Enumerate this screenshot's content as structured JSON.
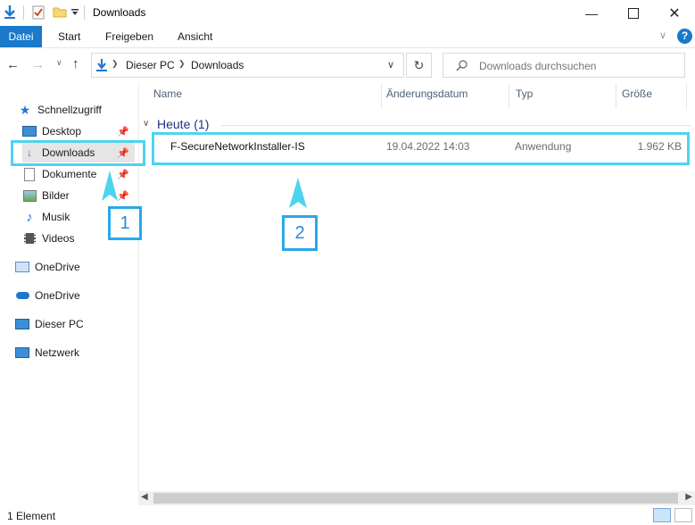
{
  "window": {
    "title": "Downloads"
  },
  "ribbon": {
    "tabs": [
      "Datei",
      "Start",
      "Freigeben",
      "Ansicht"
    ]
  },
  "address": {
    "crumbs": [
      "Dieser PC",
      "Downloads"
    ]
  },
  "search": {
    "placeholder": "Downloads durchsuchen"
  },
  "nav": {
    "quick_access": "Schnellzugriff",
    "pinned": [
      {
        "label": "Desktop",
        "icon": "desktop-icon",
        "pinned": true
      },
      {
        "label": "Downloads",
        "icon": "downloads-icon",
        "pinned": true
      },
      {
        "label": "Dokumente",
        "icon": "document-icon",
        "pinned": true
      },
      {
        "label": "Bilder",
        "icon": "pictures-icon",
        "pinned": true
      },
      {
        "label": "Musik",
        "icon": "music-icon",
        "pinned": false
      },
      {
        "label": "Videos",
        "icon": "video-icon",
        "pinned": false
      }
    ],
    "roots": [
      {
        "label": "OneDrive",
        "icon": "onedrive-business-icon"
      },
      {
        "label": "OneDrive",
        "icon": "onedrive-icon"
      },
      {
        "label": "Dieser PC",
        "icon": "this-pc-icon"
      },
      {
        "label": "Netzwerk",
        "icon": "network-icon"
      }
    ]
  },
  "columns": [
    "Name",
    "Änderungsdatum",
    "Typ",
    "Größe"
  ],
  "group": {
    "label": "Heute (1)"
  },
  "files": [
    {
      "name": "F-SecureNetworkInstaller-IS",
      "date": "19.04.2022 14:03",
      "type": "Anwendung",
      "size": "1.962 KB"
    }
  ],
  "annotations": {
    "marker1": "1",
    "marker2": "2",
    "color": "#4dd3f0"
  },
  "status": {
    "count": "1 Element"
  },
  "colors": {
    "accent": "#1979ca",
    "help": "#1979ca"
  }
}
